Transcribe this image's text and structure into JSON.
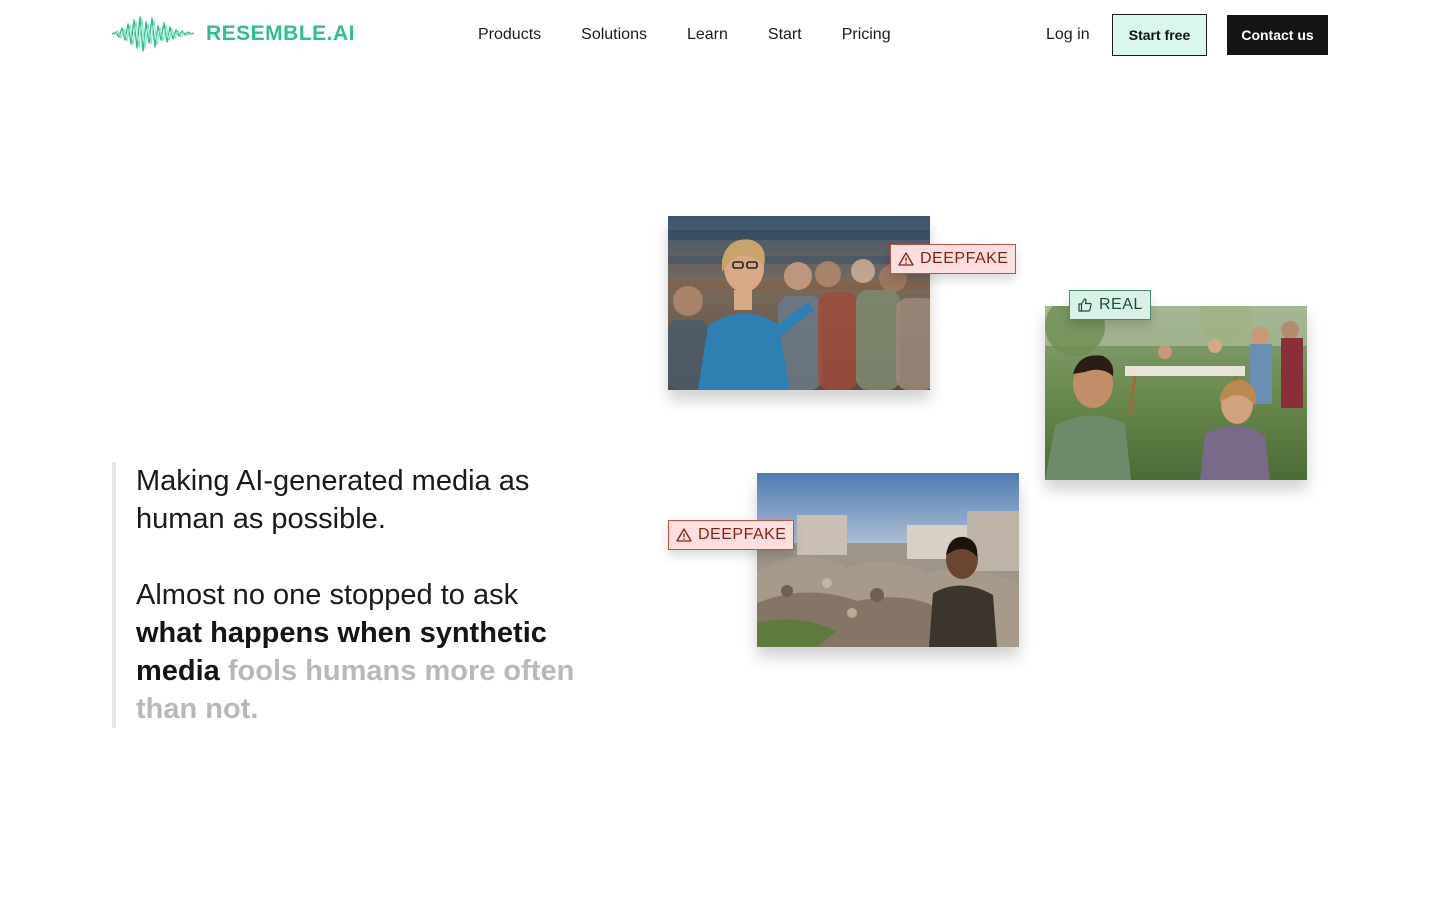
{
  "brand": {
    "name": "RESEMBLE.AI",
    "accent_color": "#2fbf8f",
    "logo_icon": "waveform-icon"
  },
  "nav": {
    "items": [
      {
        "label": "Products"
      },
      {
        "label": "Solutions"
      },
      {
        "label": "Learn"
      },
      {
        "label": "Start"
      },
      {
        "label": "Pricing"
      }
    ]
  },
  "actions": {
    "login_label": "Log in",
    "start_label": "Start free",
    "contact_label": "Contact us"
  },
  "hero": {
    "line1": "Making AI-generated media as human as possible.",
    "line2_lead": "Almost no one stopped to ask ",
    "line2_bold": "what happens when synthetic media",
    "line2_faded": " fools humans more often than not."
  },
  "cards": [
    {
      "tag": "DEEPFAKE",
      "tag_icon": "warning-triangle-icon",
      "tag_color": "#c0504a",
      "subject": "speaker-presenting-to-audience"
    },
    {
      "tag": "REAL",
      "tag_icon": "thumbs-up-icon",
      "tag_color": "#4a8b6e",
      "subject": "family-outdoor-gathering"
    },
    {
      "tag": "DEEPFAKE",
      "tag_icon": "warning-triangle-icon",
      "tag_color": "#c0504a",
      "subject": "man-viewing-destroyed-buildings"
    }
  ]
}
